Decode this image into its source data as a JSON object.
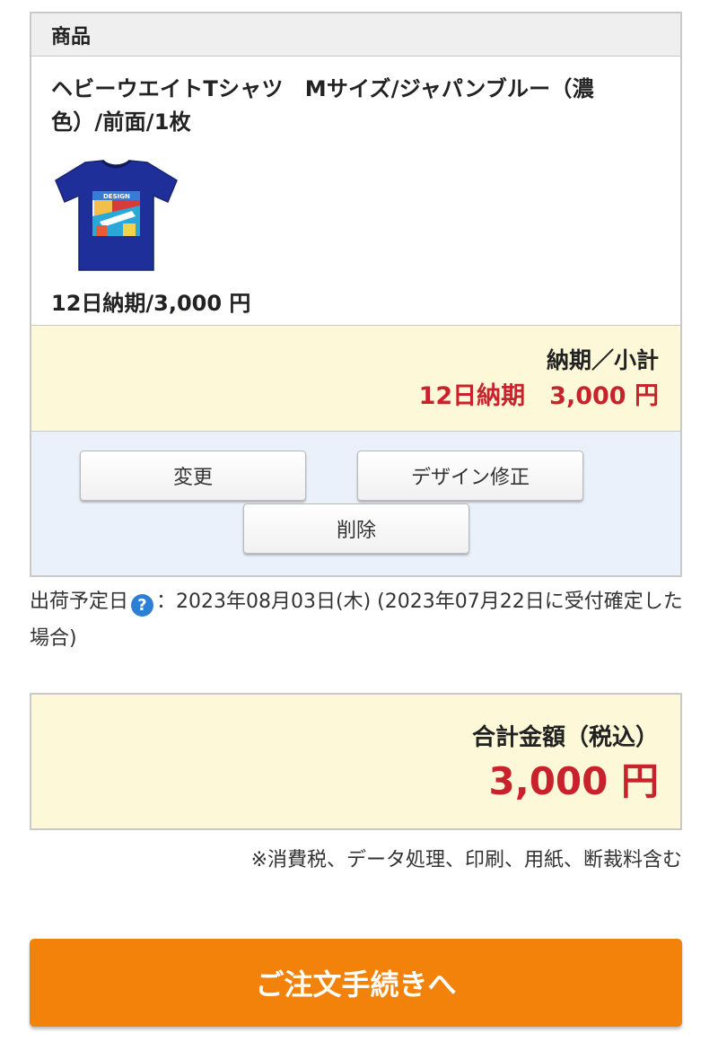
{
  "cart": {
    "header": "商品",
    "item": {
      "name": "ヘビーウエイトTシャツ　Mサイズ/ジャパンブルー（濃色）/前面/1枚",
      "image_icon": "tshirt-design-thumbnail",
      "price_line": "12日納期/3,000 円"
    },
    "subtotal": {
      "label": "納期／小計",
      "value": "12日納期　3,000 円"
    },
    "actions": {
      "change": "変更",
      "edit_design": "デザイン修正",
      "delete": "削除"
    }
  },
  "shipping": {
    "label": "出荷予定日",
    "help_icon": "question-icon",
    "text": "：2023年08月03日(木) (2023年07月22日に受付確定した場合)"
  },
  "total": {
    "label": "合計金額（税込）",
    "value": "3,000 円"
  },
  "tax_note": "※消費税、データ処理、印刷、用紙、断裁料含む",
  "checkout_label": "ご注文手続きへ",
  "colors": {
    "price_red": "#c8232c",
    "checkout_orange": "#f2820a",
    "subtotal_bg": "#fdf9d8",
    "actions_bg": "#eaf1fa",
    "tshirt_blue": "#1f2f9a"
  }
}
